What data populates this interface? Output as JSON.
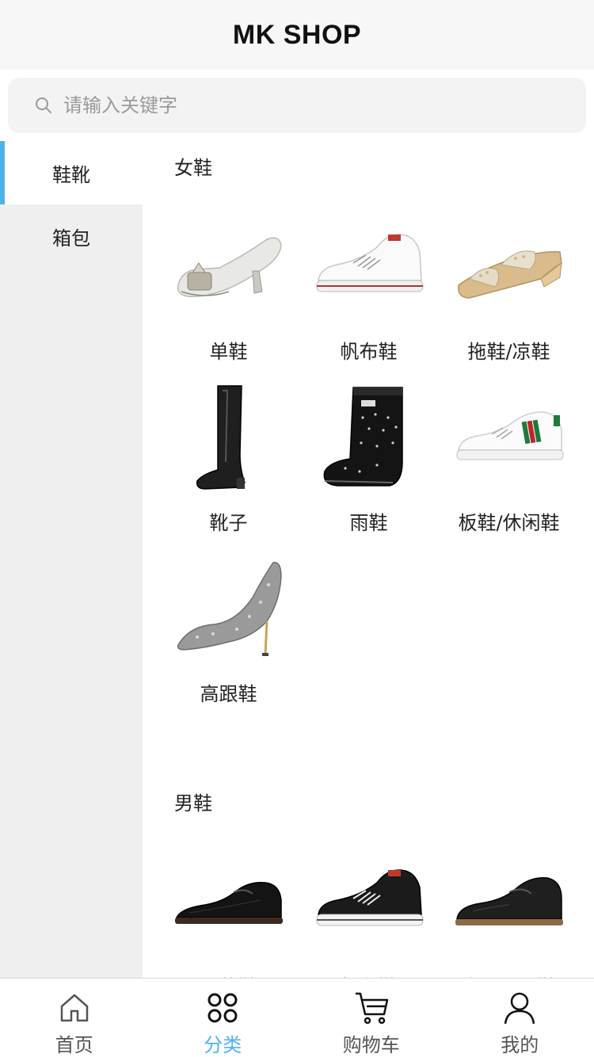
{
  "header": {
    "title": "MK SHOP"
  },
  "search": {
    "placeholder": "请输入关键字",
    "icon": "search-icon"
  },
  "sidebar": {
    "items": [
      {
        "label": "鞋靴",
        "active": true
      },
      {
        "label": "箱包",
        "active": false
      }
    ]
  },
  "sections": [
    {
      "title": "女鞋",
      "items": [
        {
          "label": "单鞋",
          "icon": "pump-shoe-icon"
        },
        {
          "label": "帆布鞋",
          "icon": "canvas-sneaker-icon"
        },
        {
          "label": "拖鞋/凉鞋",
          "icon": "sandal-icon"
        },
        {
          "label": "靴子",
          "icon": "boot-icon"
        },
        {
          "label": "雨鞋",
          "icon": "rain-boot-icon"
        },
        {
          "label": "板鞋/休闲鞋",
          "icon": "casual-sneaker-icon"
        },
        {
          "label": "高跟鞋",
          "icon": "high-heel-icon"
        }
      ]
    },
    {
      "title": "男鞋",
      "items": [
        {
          "label": "正装鞋",
          "icon": "dress-shoe-icon"
        },
        {
          "label": "帆布鞋",
          "icon": "canvas-sneaker-black-icon"
        },
        {
          "label": "商务休闲鞋",
          "icon": "business-casual-shoe-icon"
        }
      ]
    }
  ],
  "tabbar": {
    "items": [
      {
        "label": "首页",
        "icon": "home-icon",
        "active": false
      },
      {
        "label": "分类",
        "icon": "category-icon",
        "active": true
      },
      {
        "label": "购物车",
        "icon": "cart-icon",
        "active": false
      },
      {
        "label": "我的",
        "icon": "user-icon",
        "active": false
      }
    ]
  },
  "colors": {
    "accent": "#4fb1ea",
    "sidebar_bg": "#efefef",
    "header_bg": "#f7f7f7"
  }
}
